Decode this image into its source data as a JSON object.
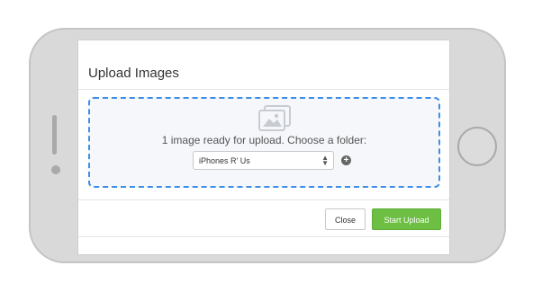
{
  "modal": {
    "title": "Upload Images",
    "status_text": "1 image ready for upload. Choose a folder:",
    "folder_select": {
      "selected": "iPhones R' Us"
    },
    "close_label": "Close",
    "start_upload_label": "Start Upload"
  },
  "icons": {
    "dropzone": "images-icon",
    "add_folder": "plus-circle-icon",
    "select_arrows": "up-down-arrows-icon"
  },
  "colors": {
    "dropzone_border": "#3d8ee6",
    "primary_button": "#6cbf42",
    "phone_body": "#d9d9d9"
  }
}
